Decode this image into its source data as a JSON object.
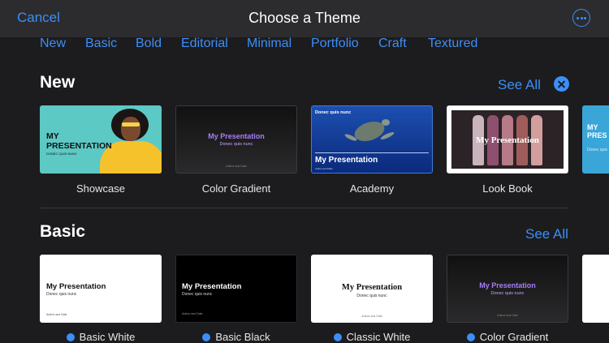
{
  "header": {
    "cancel": "Cancel",
    "title": "Choose a Theme",
    "more_icon": "ellipsis-circle-icon"
  },
  "categories": [
    "New",
    "Basic",
    "Bold",
    "Editorial",
    "Minimal",
    "Portfolio",
    "Craft",
    "Textured"
  ],
  "sections": {
    "new": {
      "title": "New",
      "see_all": "See All",
      "themes": [
        {
          "name": "Showcase",
          "title": "MY PRESENTATION",
          "subtitle": "DONEC QUIS NUNC"
        },
        {
          "name": "Color Gradient",
          "title": "My Presentation",
          "subtitle": "Donec quis nunc",
          "footer": "Author and Date"
        },
        {
          "name": "Academy",
          "caption": "Donec quis nunc",
          "title": "My Presentation",
          "footer": "Author and Date"
        },
        {
          "name": "Look Book",
          "title": "My Presentation"
        },
        {
          "title": "MY PRES",
          "subtitle": "Donec quis"
        }
      ]
    },
    "basic": {
      "title": "Basic",
      "see_all": "See All",
      "themes": [
        {
          "name": "Basic White",
          "title": "My Presentation",
          "subtitle": "Donec quis nunc",
          "footer": "Author and Date"
        },
        {
          "name": "Basic Black",
          "title": "My Presentation",
          "subtitle": "Donec quis nunc",
          "footer": "Author and Date"
        },
        {
          "name": "Classic White",
          "title": "My Presentation",
          "subtitle": "Donec quis nunc",
          "footer": "Author and Date"
        },
        {
          "name": "Color Gradient",
          "title": "My Presentation",
          "subtitle": "Donec quis nunc",
          "footer": "Author and Date"
        }
      ]
    }
  },
  "colors": {
    "accent": "#3d8ef7",
    "background": "#1c1c1e",
    "header": "#2c2c2e"
  }
}
